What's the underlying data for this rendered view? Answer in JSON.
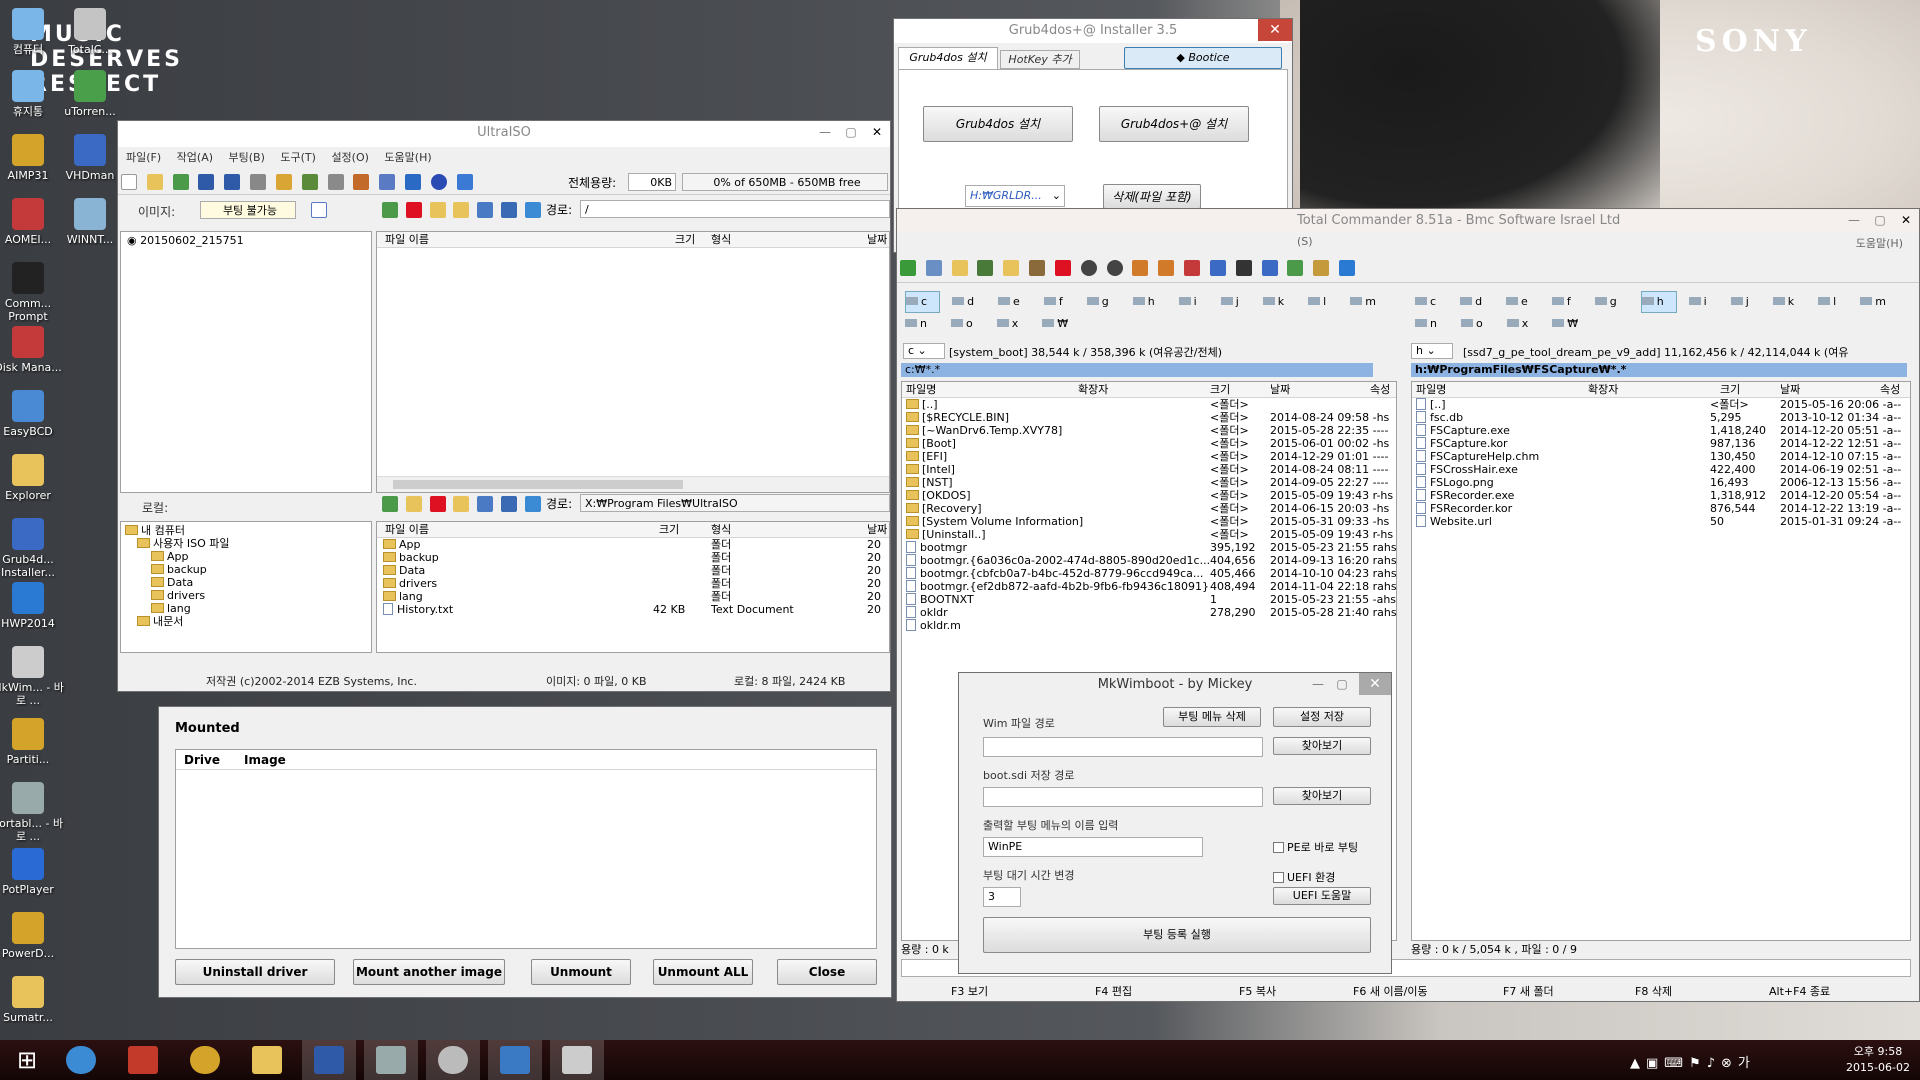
{
  "desktop": {
    "brand": "SONY",
    "logo_lines": [
      "MUSIC",
      "DESERVES",
      "RESPECT"
    ],
    "icons": [
      {
        "label": "컴퓨터",
        "icon": "computer-icon"
      },
      {
        "label": "TotalC...",
        "icon": "totalcmd-icon"
      },
      {
        "label": "휴지통",
        "icon": "recycle-bin-icon"
      },
      {
        "label": "uTorren...",
        "icon": "utorrent-icon"
      },
      {
        "label": "AIMP31",
        "icon": "aimp-icon"
      },
      {
        "label": "VHDman",
        "icon": "vhdman-icon"
      },
      {
        "label": "AOMEI...",
        "icon": "aomei-icon"
      },
      {
        "label": "WINNT...",
        "icon": "winnt-icon"
      },
      {
        "label": "Comm... Prompt",
        "icon": "cmd-icon"
      },
      {
        "label": "Disk Mana...",
        "icon": "disk-icon"
      },
      {
        "label": "EasyBCD",
        "icon": "easybcd-icon"
      },
      {
        "label": "Explorer",
        "icon": "explorer-icon"
      },
      {
        "label": "Grub4d... Installer...",
        "icon": "grub-icon"
      },
      {
        "label": "HWP2014",
        "icon": "hwp-icon"
      },
      {
        "label": "MkWim... - 바로 ...",
        "icon": "mkwim-icon"
      },
      {
        "label": "Partiti...",
        "icon": "partition-icon"
      },
      {
        "label": "Portabl... - 바로 ...",
        "icon": "portable-icon"
      },
      {
        "label": "PotPlayer",
        "icon": "potplayer-icon"
      },
      {
        "label": "PowerD...",
        "icon": "powerdvd-icon"
      },
      {
        "label": "Sumatr...",
        "icon": "sumatra-icon"
      }
    ]
  },
  "grub": {
    "title": "Grub4dos+@ Installer 3.5",
    "tab1": "Grub4dos 설치",
    "tab2": "HotKey 추가",
    "bootice": "Bootice",
    "install": "Grub4dos 설치",
    "install_at": "Grub4dos+@ 설치",
    "drive": "H:₩GRLDR...",
    "delete": "삭제(파일 포함)"
  },
  "ultraiso": {
    "title": "UltraISO",
    "menu": [
      "파일(F)",
      "작업(A)",
      "부팅(B)",
      "도구(T)",
      "설정(O)",
      "도움말(H)"
    ],
    "total_label": "전체용량:",
    "total_value": "0KB",
    "progress": "0% of 650MB - 650MB free",
    "image_label": "이미지:",
    "boot_state": "부팅 불가능",
    "path_label": "경로:",
    "path_value": "/",
    "tree_root": "20150602_215751",
    "col_name": "파일 이름",
    "col_size": "크기",
    "col_type": "형식",
    "col_date": "날짜",
    "local_label": "로컬:",
    "local_path": "X:₩Program Files₩UltraISO",
    "local_tree": [
      "내 컴퓨터",
      "사용자 ISO 파일",
      "App",
      "backup",
      "Data",
      "drivers",
      "lang",
      "내문서"
    ],
    "local_files": [
      {
        "name": "App",
        "size": "",
        "type": "폴더",
        "date": "20"
      },
      {
        "name": "backup",
        "size": "",
        "type": "폴더",
        "date": "20"
      },
      {
        "name": "Data",
        "size": "",
        "type": "폴더",
        "date": "20"
      },
      {
        "name": "drivers",
        "size": "",
        "type": "폴더",
        "date": "20"
      },
      {
        "name": "lang",
        "size": "",
        "type": "폴더",
        "date": "20"
      },
      {
        "name": "History.txt",
        "size": "42 KB",
        "type": "Text Document",
        "date": "20"
      }
    ],
    "status_copyright": "저작권 (c)2002-2014 EZB Systems, Inc.",
    "status_image": "이미지: 0 파일, 0 KB",
    "status_local": "로컬: 8 파일, 2424 KB"
  },
  "mount": {
    "section": "Mounted",
    "col_drive": "Drive",
    "col_image": "Image",
    "buttons": [
      "Uninstall driver",
      "Mount another image",
      "Unmount",
      "Unmount ALL",
      "Close"
    ]
  },
  "tc": {
    "title": "Total Commander 8.51a - Bmc Software Israel Ltd",
    "menu_right": "도움말(H)",
    "menu_left": "(S)",
    "drives": [
      "c",
      "d",
      "e",
      "f",
      "g",
      "h",
      "i",
      "j",
      "k",
      "l",
      "m",
      "n",
      "o",
      "x",
      "₩"
    ],
    "left_drive": "c",
    "left_info": "[system_boot]  38,544 k / 358,396 k (여유공간/전체)",
    "left_path": "c:₩*.*",
    "right_drive": "h",
    "right_info": "[ssd7_g_pe_tool_dream_pe_v9_add]  11,162,456 k / 42,114,044 k (여유",
    "right_path": "h:₩ProgramFiles₩FSCapture₩*.*",
    "col_name": "파일명",
    "col_ext": "확장자",
    "col_size": "크기",
    "col_date": "날짜",
    "col_attr": "속성",
    "left_files": [
      {
        "name": "[..]",
        "size": "<폴더>",
        "date": "",
        "folder": true
      },
      {
        "name": "[$RECYCLE.BIN]",
        "size": "<폴더>",
        "date": "2014-08-24 09:58 -hs",
        "folder": true
      },
      {
        "name": "[~WanDrv6.Temp.XVY78]",
        "size": "<폴더>",
        "date": "2015-05-28 22:35 ----",
        "folder": true
      },
      {
        "name": "[Boot]",
        "size": "<폴더>",
        "date": "2015-06-01 00:02 -hs",
        "folder": true
      },
      {
        "name": "[EFI]",
        "size": "<폴더>",
        "date": "2014-12-29 01:01 ----",
        "folder": true
      },
      {
        "name": "[Intel]",
        "size": "<폴더>",
        "date": "2014-08-24 08:11 ----",
        "folder": true
      },
      {
        "name": "[NST]",
        "size": "<폴더>",
        "date": "2014-09-05 22:27 ----",
        "folder": true
      },
      {
        "name": "[OKDOS]",
        "size": "<폴더>",
        "date": "2015-05-09 19:43 r-hs",
        "folder": true
      },
      {
        "name": "[Recovery]",
        "size": "<폴더>",
        "date": "2014-06-15 20:03 -hs",
        "folder": true
      },
      {
        "name": "[System Volume Information]",
        "size": "<폴더>",
        "date": "2015-05-31 09:33 -hs",
        "folder": true
      },
      {
        "name": "[Uninstall..]",
        "size": "<폴더>",
        "date": "2015-05-09 19:43 r-hs",
        "folder": true
      },
      {
        "name": "bootmgr",
        "size": "395,192",
        "date": "2015-05-23 21:55 rahs",
        "folder": false
      },
      {
        "name": "bootmgr.{6a036c0a-2002-474d-8805-890d20ed1c...",
        "size": "404,656",
        "date": "2014-09-13 16:20 rahs",
        "folder": false
      },
      {
        "name": "bootmgr.{cbfcb0a7-b4bc-452d-8779-96ccd949ca...",
        "size": "405,466",
        "date": "2014-10-10 04:23 rahs",
        "folder": false
      },
      {
        "name": "bootmgr.{ef2db872-aafd-4b2b-9fb6-fb9436c18091}",
        "size": "408,494",
        "date": "2014-11-04 22:18 rahs",
        "folder": false
      },
      {
        "name": "BOOTNXT",
        "size": "1",
        "date": "2015-05-23 21:55 -ahs",
        "folder": false
      },
      {
        "name": "okldr",
        "size": "278,290",
        "date": "2015-05-28 21:40 rahs",
        "folder": false
      },
      {
        "name": "okldr.m",
        "size": "",
        "date": "",
        "folder": false
      }
    ],
    "right_files": [
      {
        "name": "[..]",
        "size": "<폴더>",
        "date": "2015-05-16 20:06 -a--"
      },
      {
        "name": "fsc.db",
        "size": "5,295",
        "date": "2013-10-12 01:34 -a--"
      },
      {
        "name": "FSCapture.exe",
        "size": "1,418,240",
        "date": "2014-12-20 05:51 -a--"
      },
      {
        "name": "FSCapture.kor",
        "size": "987,136",
        "date": "2014-12-22 12:51 -a--"
      },
      {
        "name": "FSCaptureHelp.chm",
        "size": "130,450",
        "date": "2014-12-10 07:15 -a--"
      },
      {
        "name": "FSCrossHair.exe",
        "size": "422,400",
        "date": "2014-06-19 02:51 -a--"
      },
      {
        "name": "FSLogo.png",
        "size": "16,493",
        "date": "2006-12-13 15:56 -a--"
      },
      {
        "name": "FSRecorder.exe",
        "size": "1,318,912",
        "date": "2014-12-20 05:54 -a--"
      },
      {
        "name": "FSRecorder.kor",
        "size": "876,544",
        "date": "2014-12-22 13:19 -a--"
      },
      {
        "name": "Website.url",
        "size": "50",
        "date": "2015-01-31 09:24 -a--"
      }
    ],
    "left_status": "용량 : 0 k",
    "right_status": "용량 : 0 k / 5,054 k , 파일 : 0 / 9",
    "fkeys": [
      "F3 보기",
      "F4 편집",
      "F5 복사",
      "F6 새 이름/이동",
      "F7 새 폴더",
      "F8 삭제",
      "Alt+F4 종료"
    ]
  },
  "mkwim": {
    "title": "MkWimboot - by Mickey",
    "delete_menu": "부팅 메뉴 삭제",
    "save": "설정 저장",
    "wim_label": "Wim 파일 경로",
    "browse1": "찾아보기",
    "sdi_label": "boot.sdi 저장 경로",
    "browse2": "찾아보기",
    "menu_label": "출력할 부팅 메뉴의 이름 입력",
    "menu_value": "WinPE",
    "pe_boot": "PE로 바로 부팅",
    "wait_label": "부팅 대기 시간 변경",
    "wait_value": "3",
    "uefi": "UEFI 환경",
    "uefi_help": "UEFI 도움말",
    "run": "부팅 등록 실행"
  },
  "taskbar": {
    "time": "오후 9:58",
    "date": "2015-06-02"
  }
}
